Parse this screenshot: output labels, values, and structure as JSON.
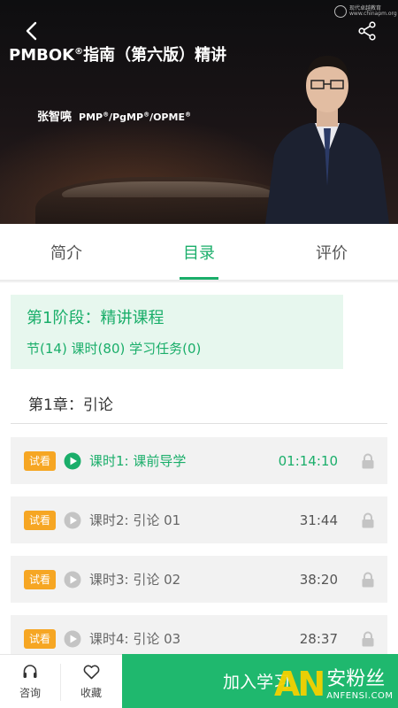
{
  "hero": {
    "title": "PMBOK",
    "title_sup": "®",
    "title_rest": "指南（第六版）精讲",
    "lecturer_name": "张智喨",
    "lecturer_creds": "PMP",
    "cred_sup1": "®",
    "cred_mid": "/PgMP",
    "cred_sup2": "®",
    "cred_end": "/OPME",
    "cred_sup3": "®",
    "logo_line1": "现代卓越教育",
    "logo_line2": "www.chinapm.org"
  },
  "tabs": [
    {
      "label": "简介",
      "active": false
    },
    {
      "label": "目录",
      "active": true
    },
    {
      "label": "评价",
      "active": false
    }
  ],
  "stage": {
    "title": "第1阶段：精讲课程",
    "stats": "节(14) 课时(80) 学习任务(0)"
  },
  "chapter": {
    "title": "第1章：引论"
  },
  "lessons": [
    {
      "badge": "试看",
      "name": "课时1: 课前导学",
      "duration": "01:14:10",
      "current": true
    },
    {
      "badge": "试看",
      "name": "课时2: 引论 01",
      "duration": "31:44",
      "current": false
    },
    {
      "badge": "试看",
      "name": "课时3: 引论 02",
      "duration": "38:20",
      "current": false
    },
    {
      "badge": "试看",
      "name": "课时4: 引论 03",
      "duration": "28:37",
      "current": false
    }
  ],
  "bottom": {
    "consult_label": "咨询",
    "favorite_label": "收藏",
    "join_label": "加入学习"
  },
  "watermark": {
    "logo": "AN",
    "cn": "安粉丝",
    "en": "ANFENSI.COM"
  },
  "colors": {
    "accent": "#1aae6a",
    "badge": "#f6a623",
    "stage_bg": "#e7f7ee",
    "join_bg": "#1fb86e"
  }
}
